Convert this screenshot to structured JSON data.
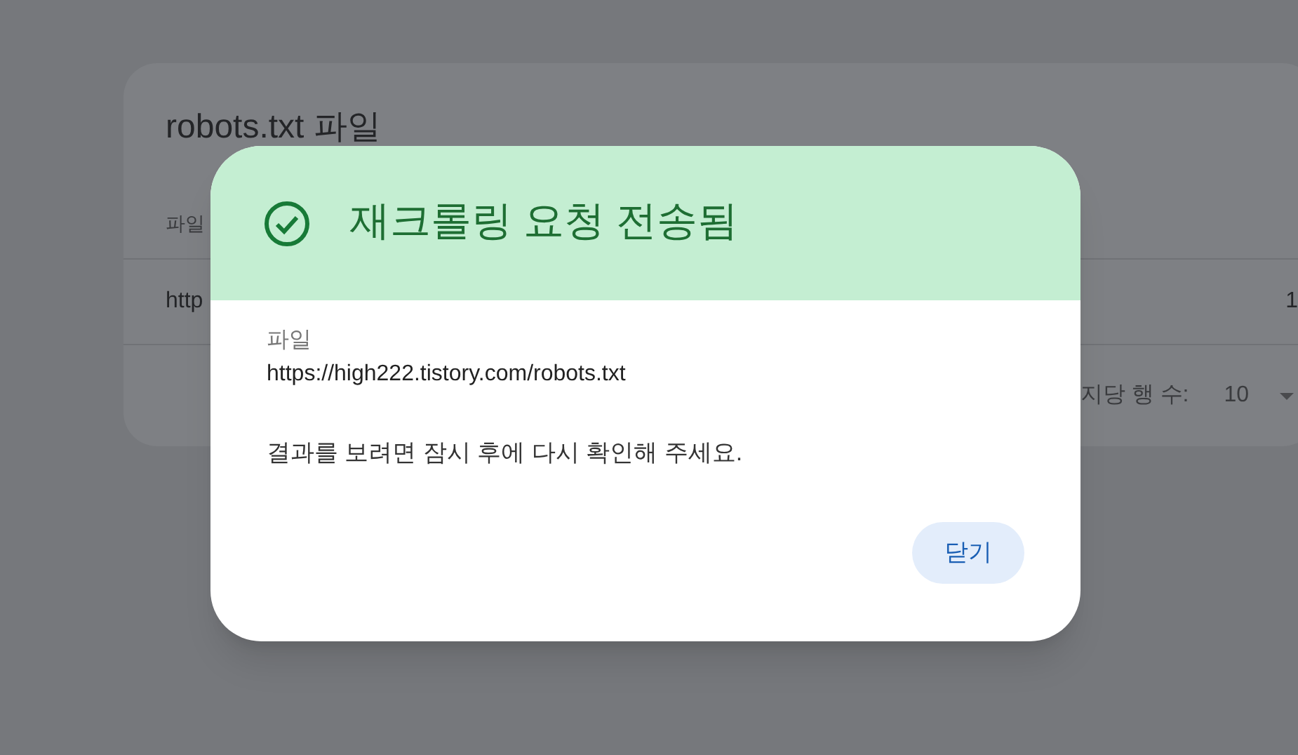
{
  "background_card": {
    "title": "robots.txt 파일",
    "table": {
      "column_1": "파일",
      "rows": [
        {
          "column_1": "http",
          "column_3": "1"
        }
      ]
    },
    "footer": {
      "rows_per_page_label": "지당 행 수:",
      "rows_per_page_value": "10"
    }
  },
  "dialog": {
    "title": "재크롤링 요청 전송됨",
    "kind": "success",
    "field_label": "파일",
    "field_value": "https://high222.tistory.com/robots.txt",
    "message": "결과를 보려면 잠시 후에 다시 확인해 주세요.",
    "buttons": [
      "닫기"
    ]
  }
}
